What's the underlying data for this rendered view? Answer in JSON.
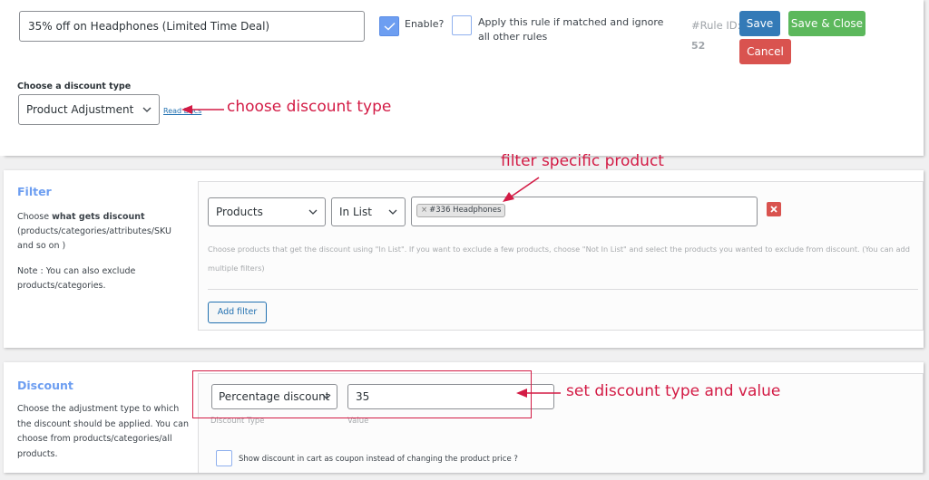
{
  "header": {
    "rule_title_value": "35% off on Headphones (Limited Time Deal)",
    "enable_label": "Enable?",
    "enable_checked": true,
    "ignore_others_label": "Apply this rule if matched and ignore all other rules",
    "ignore_others_checked": false,
    "rule_id_label": "#Rule ID:",
    "rule_id_value": "52",
    "save_label": "Save",
    "save_close_label": "Save & Close",
    "cancel_label": "Cancel"
  },
  "discount_type": {
    "label": "Choose a discount type",
    "selected": "Product Adjustment",
    "read_docs_label": "Read Docs"
  },
  "filter": {
    "title": "Filter",
    "desc_prefix": "Choose ",
    "desc_bold": "what gets discount",
    "desc_suffix": " (products/categories/attributes/SKU and so on )",
    "note": "Note : You can also exclude products/categories.",
    "type_selected": "Products",
    "method_selected": "In List",
    "tags": [
      {
        "remove": "×",
        "label": "#336 Headphones"
      }
    ],
    "help_text": "Choose products that get the discount using \"In List\". If you want to exclude a few products, choose \"Not In List\" and select the products you wanted to exclude from discount. (You can add multiple filters)",
    "add_filter_label": "Add filter"
  },
  "discount": {
    "title": "Discount",
    "desc": "Choose the adjustment type to which the discount should be applied. You can choose from products/categories/all products.",
    "type_selected": "Percentage discount",
    "value": "35",
    "type_sublabel": "Discount Type",
    "value_sublabel": "Value",
    "coupon_label": "Show discount in cart as coupon instead of changing the product price ?",
    "coupon_checked": false
  },
  "annotations": {
    "choose_type": "choose discount type",
    "filter_product": "filter specific product",
    "set_discount": "set discount type and value"
  },
  "colors": {
    "accent_blue": "#6d9ef1",
    "save_blue": "#337ab7",
    "save_close_green": "#5cb85c",
    "cancel_red": "#d9534f",
    "annotation_red": "#d31b45"
  }
}
